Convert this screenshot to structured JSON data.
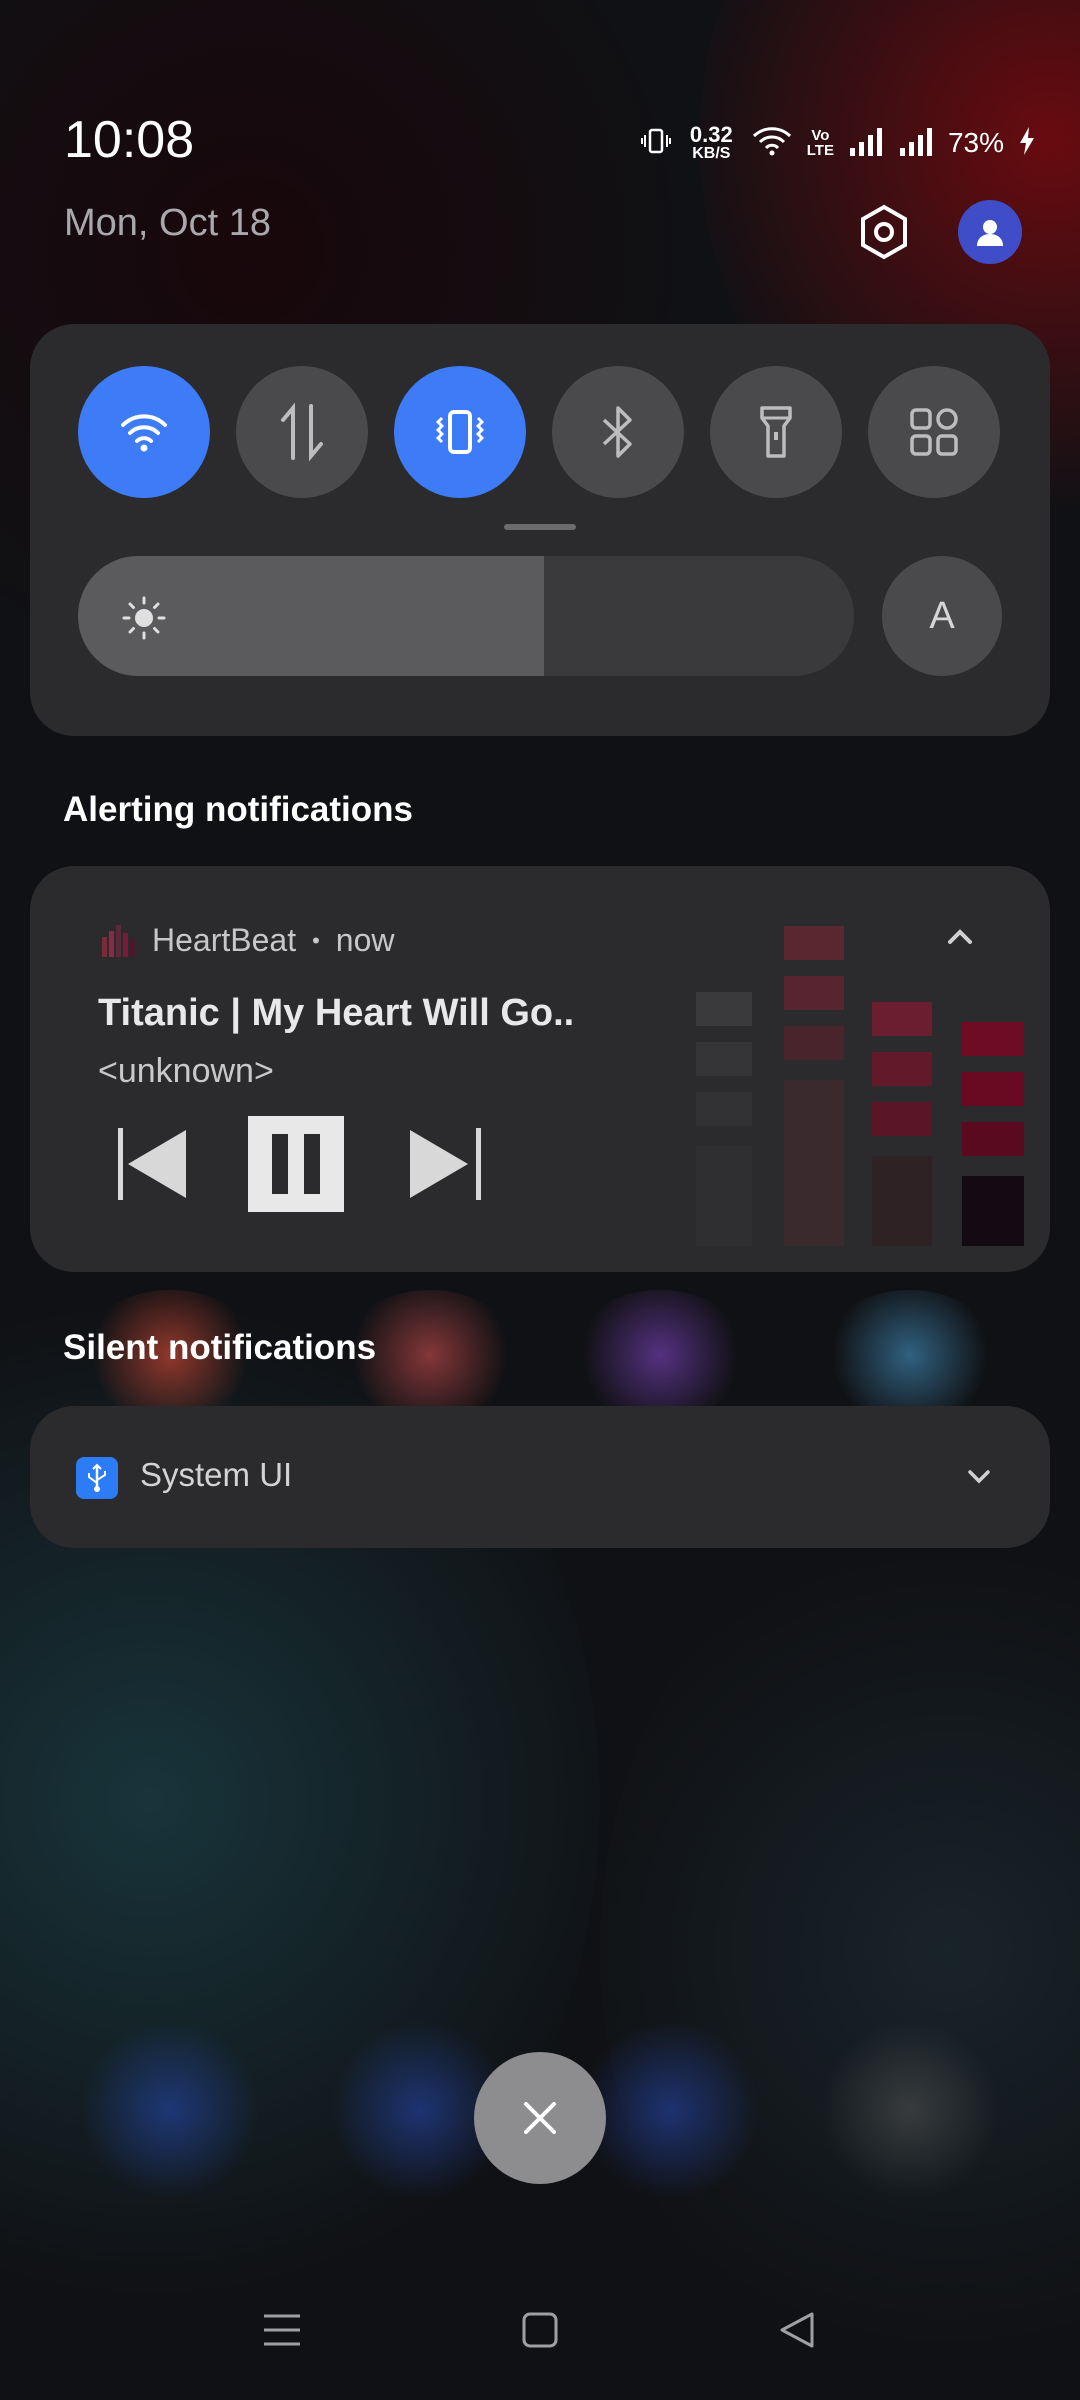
{
  "status_bar": {
    "time": "10:08",
    "date": "Mon, Oct 18",
    "net_speed_value": "0.32",
    "net_speed_unit": "KB/S",
    "volte_line1": "Vo",
    "volte_line2": "LTE",
    "battery": "73%"
  },
  "quick_settings": {
    "tiles": [
      {
        "id": "wifi",
        "icon": "wifi-icon",
        "on": true
      },
      {
        "id": "mobile-data",
        "icon": "data-arrows-icon",
        "on": false
      },
      {
        "id": "vibrate",
        "icon": "vibrate-icon",
        "on": true
      },
      {
        "id": "bluetooth",
        "icon": "bluetooth-icon",
        "on": false
      },
      {
        "id": "flashlight",
        "icon": "flashlight-icon",
        "on": false
      },
      {
        "id": "more",
        "icon": "grid-icon",
        "on": false
      }
    ],
    "brightness_fraction": 0.6,
    "auto_brightness_label": "A"
  },
  "sections": {
    "alerting": "Alerting notifications",
    "silent": "Silent notifications"
  },
  "media": {
    "app": "HeartBeat",
    "separator": "•",
    "time": "now",
    "song": "Titanic | My Heart Will Go..",
    "artist": "<unknown>"
  },
  "silent_notification": {
    "app": "System UI",
    "icon": "usb-icon"
  },
  "colors": {
    "accent": "#3d7bf7",
    "panel": "#2b2b2d",
    "tile_off": "#4a4a4c"
  }
}
